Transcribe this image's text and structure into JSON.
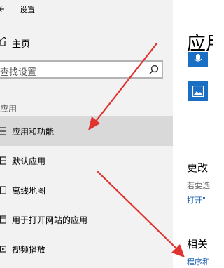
{
  "window": {
    "title": "设置"
  },
  "sidebar": {
    "home_label": "主页",
    "search": {
      "text": "查找设置"
    },
    "section_label": "应用",
    "items": [
      {
        "label": "应用和功能",
        "icon": "list-icon",
        "selected": true
      },
      {
        "label": "默认应用",
        "icon": "default-apps-icon"
      },
      {
        "label": "离线地图",
        "icon": "map-icon"
      },
      {
        "label": "用于打开网站的应用",
        "icon": "web-link-icon"
      },
      {
        "label": "视频播放",
        "icon": "video-icon"
      }
    ]
  },
  "main": {
    "title": "应用",
    "tiles": [
      {
        "icon": "microphone-icon"
      },
      {
        "icon": "image-icon"
      }
    ],
    "change_heading": "更改",
    "change_text": "若要选",
    "change_link": "打开\"",
    "related_heading": "相关",
    "related_link": "程序和"
  },
  "colors": {
    "sidebar_bg": "#f2f2f2",
    "selected_bg": "#d9d9d9",
    "accent": "#1a6fc4",
    "link": "#1a5fb4",
    "annotation_arrow": "#e0332f"
  }
}
